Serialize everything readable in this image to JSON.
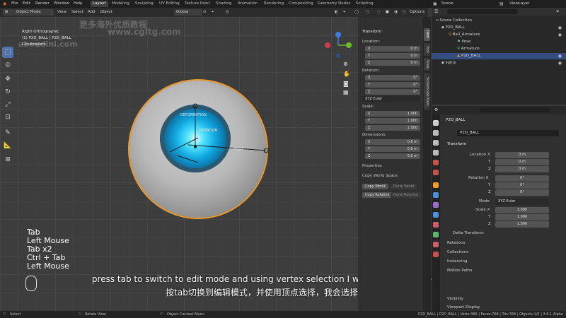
{
  "topbar": {
    "menus": [
      "File",
      "Edit",
      "Render",
      "Window",
      "Help"
    ],
    "workspaces": [
      "Layout",
      "Modeling",
      "Sculpting",
      "UV Editing",
      "Texture Paint",
      "Shading",
      "Animation",
      "Rendering",
      "Compositing",
      "Geometry Nodes",
      "Scripting"
    ],
    "active_workspace": "Layout",
    "scene_label": "Scene",
    "viewlayer_label": "ViewLayer"
  },
  "viewport_header": {
    "mode": "Object Mode",
    "menus": [
      "View",
      "Select",
      "Add",
      "Object"
    ],
    "transform_orientation": "Global",
    "options_label": "Options"
  },
  "viewport": {
    "view_name": "Right Orthographic",
    "object_info": "(1) P2D_BALL | P2D_BALL",
    "units": "Centimeters",
    "bone_labels": [
      "DEFORMATION",
      "ROTATION",
      "ROOT"
    ]
  },
  "key_log": [
    "Tab",
    "Left Mouse",
    "Tab x2",
    "Ctrl + Tab",
    "Left Mouse"
  ],
  "subtitle": {
    "en": "press tab to switch to edit mode and using vertex selection I will select the bottom vertex",
    "zh": "按tab切换到编辑模式，并使用顶点选择，我会选择底部的顶点"
  },
  "watermarks": [
    "更多海外优质教程",
    "www.cgltg.com",
    "aboudini.com"
  ],
  "npanel": {
    "transform_title": "Transform",
    "location_label": "Location:",
    "location": [
      {
        "axis": "X",
        "value": "0 m"
      },
      {
        "axis": "Y",
        "value": "0 m"
      },
      {
        "axis": "Z",
        "value": "0 m"
      }
    ],
    "rotation_label": "Rotation:",
    "rotation": [
      {
        "axis": "X",
        "value": "0°"
      },
      {
        "axis": "Y",
        "value": "0°"
      },
      {
        "axis": "Z",
        "value": "0°"
      }
    ],
    "rotation_mode": "XYZ Euler",
    "scale_label": "Scale:",
    "scale": [
      {
        "axis": "X",
        "value": "1.000"
      },
      {
        "axis": "Y",
        "value": "1.000"
      },
      {
        "axis": "Z",
        "value": "1.000"
      }
    ],
    "dimensions_label": "Dimensions:",
    "dimensions": [
      {
        "axis": "X",
        "value": "0.6 m"
      },
      {
        "axis": "Y",
        "value": "0.6 m"
      },
      {
        "axis": "Z",
        "value": "0.6 m"
      }
    ],
    "properties_label": "Properties",
    "copy_world_space_label": "Copy World Space",
    "copy_world_btn": "Copy World",
    "paste_world_btn": "Paste World",
    "copy_relative_btn": "Copy Relative",
    "paste_relative_btn": "Paste Relative"
  },
  "sidetabs": [
    "Item",
    "Tool",
    "View",
    "Screencast Keys"
  ],
  "outliner": {
    "title": "Scene Collection",
    "rows": [
      {
        "label": "Scene Collection",
        "indent": 0
      },
      {
        "label": "P2D_BALL",
        "indent": 1
      },
      {
        "label": "Ball_Armature",
        "indent": 2
      },
      {
        "label": "Pose",
        "indent": 3
      },
      {
        "label": "Armature",
        "indent": 3
      },
      {
        "label": "P2D_BALL",
        "indent": 3,
        "selected": true
      },
      {
        "label": "lights",
        "indent": 1
      }
    ]
  },
  "properties": {
    "object_name": "P2D_BALL",
    "object_field": "P2D_BALL",
    "transform_title": "Transform",
    "location_label": "Location X",
    "location": [
      "0 m",
      "0 m",
      "0 m"
    ],
    "rotation_label": "Rotation X",
    "rotation": [
      "0°",
      "0°",
      "0°"
    ],
    "mode_label": "Mode",
    "mode_value": "XYZ Euler",
    "scale_label": "Scale X",
    "scale": [
      "1.000",
      "1.000",
      "1.000"
    ],
    "axis_y": "Y",
    "axis_z": "Z",
    "sections": [
      "Delta Transform",
      "Relations",
      "Collections",
      "Instancing",
      "Motion Paths",
      "Visibility",
      "Viewport Display"
    ]
  },
  "statusbar": {
    "left_items": [
      "Select",
      "Rotate View",
      "Object Context Menu"
    ],
    "right": "P2D_BALL | P2D_BALL | Verts:386 | Faces:768 | Tris:768 | Objects:1/5 | 3.6.1 Alpha"
  },
  "colors": {
    "accent_blue": "#4f73a8",
    "selection_orange": "#f09a2c",
    "eye_cyan": "#4fe3ff"
  }
}
